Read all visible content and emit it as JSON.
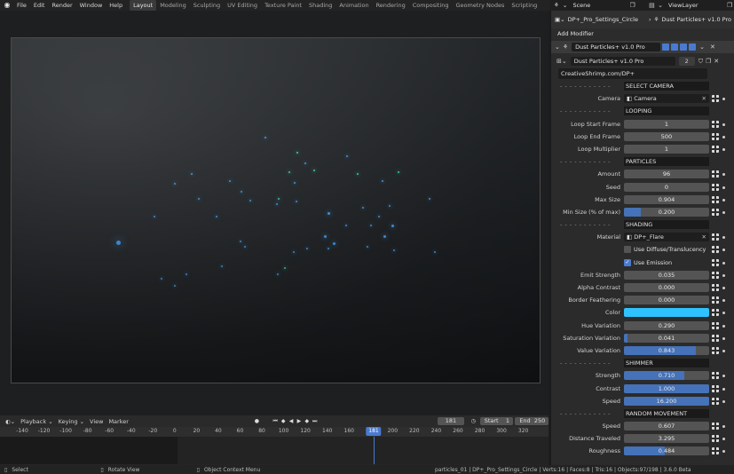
{
  "app": {
    "menu": [
      "File",
      "Edit",
      "Render",
      "Window",
      "Help"
    ],
    "workspaces": [
      "Layout",
      "Modeling",
      "Sculpting",
      "UV Editing",
      "Texture Paint",
      "Shading",
      "Animation",
      "Rendering",
      "Compositing",
      "Geometry Nodes",
      "Scripting"
    ],
    "active_workspace": "Layout",
    "scene": "Scene",
    "view_layer": "ViewLayer"
  },
  "properties": {
    "breadcrumb_object": "DP+_Pro_Settings_Circle",
    "breadcrumb_modifier": "Dust Particles+ v1.0 Pro",
    "add_modifier": "Add Modifier",
    "modifier_name": "Dust Particles+ v1.0 Pro",
    "node_group": "Dust Particles+ v1.0 Pro",
    "node_group_users": "2",
    "url": "CreativeShrimp.com/DP+",
    "rows": [
      {
        "kind": "section",
        "sep": "- - - - - - - - - - -",
        "text": "SELECT CAMERA"
      },
      {
        "kind": "object",
        "label": "Camera",
        "text": "Camera",
        "icon": "camera-icon"
      },
      {
        "kind": "section",
        "sep": "- - - - - - - - - - -",
        "text": "LOOPING"
      },
      {
        "kind": "number",
        "label": "Loop Start Frame",
        "text": "1"
      },
      {
        "kind": "number",
        "label": "Loop End Frame",
        "text": "500"
      },
      {
        "kind": "number",
        "label": "Loop Multiplier",
        "text": "1"
      },
      {
        "kind": "section",
        "sep": "- - - - - - - - - - -",
        "text": "PARTICLES"
      },
      {
        "kind": "number",
        "label": "Amount",
        "text": "96"
      },
      {
        "kind": "number",
        "label": "Seed",
        "text": "0"
      },
      {
        "kind": "number",
        "label": "Max Size",
        "text": "0.904"
      },
      {
        "kind": "number",
        "label": "Min Size (% of max)",
        "text": "0.200",
        "fill": 0.2
      },
      {
        "kind": "section",
        "sep": "- - - - - - - - - - -",
        "text": "SHADING"
      },
      {
        "kind": "object",
        "label": "Material",
        "text": "DP+_Flare",
        "icon": "material-icon"
      },
      {
        "kind": "check",
        "text": "Use Diffuse/Translucency",
        "checked": false
      },
      {
        "kind": "check",
        "text": "Use Emission",
        "checked": true
      },
      {
        "kind": "number",
        "label": "Emit Strength",
        "text": "0.035"
      },
      {
        "kind": "number",
        "label": "Alpha Contrast",
        "text": "0.000"
      },
      {
        "kind": "number",
        "label": "Border Feathering",
        "text": "0.000"
      },
      {
        "kind": "color",
        "label": "Color",
        "color": "#2ec3ff"
      },
      {
        "kind": "number",
        "label": "Hue Variation",
        "text": "0.290"
      },
      {
        "kind": "number",
        "label": "Saturation Variation",
        "text": "0.041",
        "fill": 0.041
      },
      {
        "kind": "number",
        "label": "Value Variation",
        "text": "0.843",
        "fill": 0.843
      },
      {
        "kind": "section",
        "sep": "- - - - - - - - - - -",
        "text": "SHIMMER"
      },
      {
        "kind": "number",
        "label": "Strength",
        "text": "0.710",
        "fill": 0.71
      },
      {
        "kind": "number",
        "label": "Contrast",
        "text": "1.000",
        "fill": 1.0
      },
      {
        "kind": "number",
        "label": "Speed",
        "text": "16.200",
        "fill": 1.0
      },
      {
        "kind": "section",
        "sep": "- - - - - - - - - - -",
        "text": "RANDOM MOVEMENT"
      },
      {
        "kind": "number",
        "label": "Speed",
        "text": "0.607"
      },
      {
        "kind": "number",
        "label": "Distance Traveled",
        "text": "3.295"
      },
      {
        "kind": "number",
        "label": "Roughness",
        "text": "0.484",
        "fill": 0.484
      }
    ]
  },
  "timeline": {
    "playback": "Playback",
    "keying": "Keying",
    "view": "View",
    "marker": "Marker",
    "current_frame": "181",
    "start_label": "Start",
    "start": "1",
    "end_label": "End",
    "end": "250",
    "ticks": [
      "-140",
      "-120",
      "-100",
      "-80",
      "-60",
      "-40",
      "-20",
      "0",
      "20",
      "40",
      "60",
      "80",
      "100",
      "120",
      "140",
      "160",
      "180",
      "200",
      "220",
      "240",
      "260",
      "280",
      "300",
      "320"
    ],
    "cursor": "181"
  },
  "status": {
    "select": "Select",
    "rotate": "Rotate View",
    "context": "Object Context Menu",
    "info": "particles_01 | DP+_Pro_Settings_Circle | Verts:16 | Faces:8 | Tris:16 | Objects:97/198 | 3.6.0 Beta"
  },
  "colors": {
    "accent": "#4a7ad0",
    "emission": "#2ec3ff",
    "particle_blue": "#4aa8ff",
    "particle_teal": "#44e6c2"
  }
}
